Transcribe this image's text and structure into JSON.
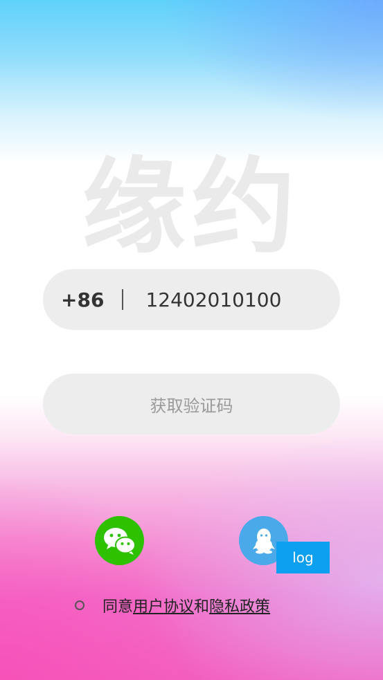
{
  "logo": {
    "text": "缘约"
  },
  "phone": {
    "country_code": "+86",
    "number": "12402010100"
  },
  "get_code_button": {
    "label": "获取验证码"
  },
  "social_login": {
    "wechat_icon": "wechat-icon",
    "qq_icon": "qq-icon",
    "wechat_color": "#2dc100",
    "qq_color": "#4aa9e8",
    "log_tag": "log"
  },
  "agreement": {
    "prefix": "同意",
    "user_agreement": "用户协议",
    "conjunction": "和",
    "privacy_policy": "隐私政策"
  }
}
